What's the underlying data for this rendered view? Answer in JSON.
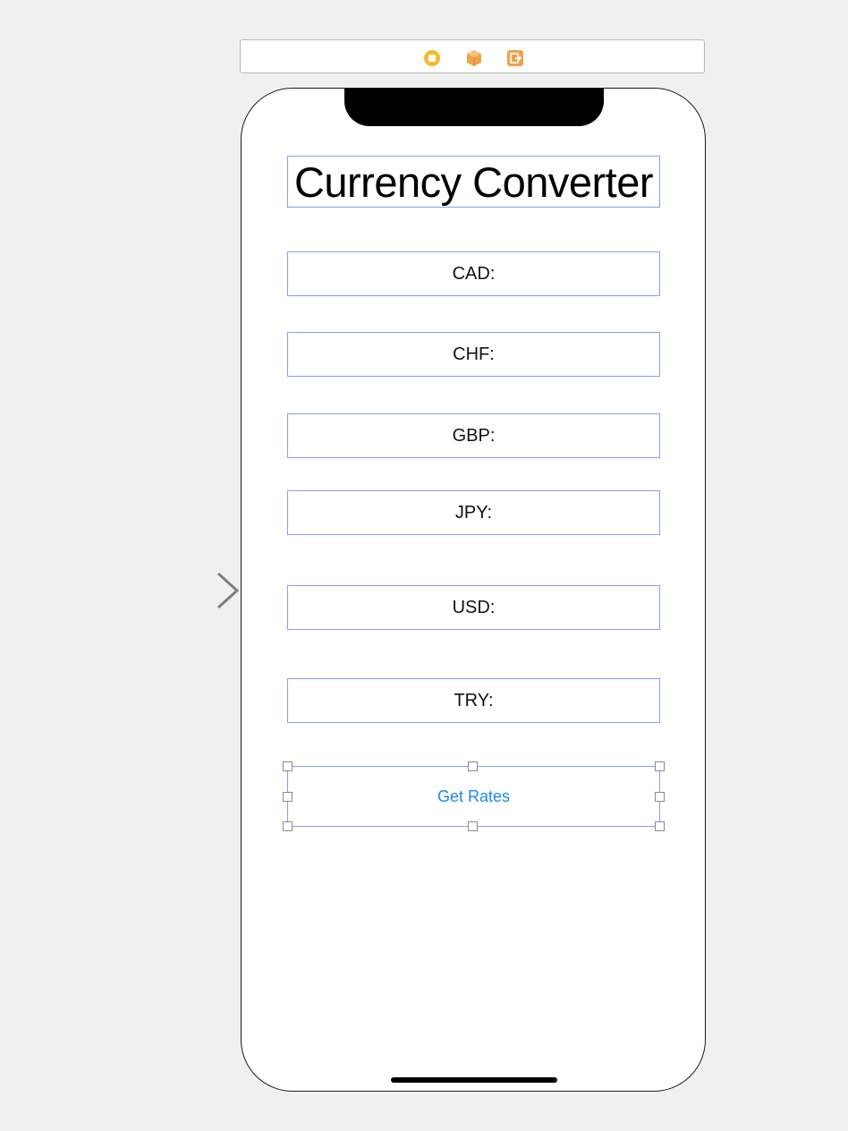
{
  "scene_dock": {
    "icons": [
      "view-controller-icon",
      "first-responder-icon",
      "exit-icon"
    ],
    "colors": {
      "view_controller": "#f5b92e",
      "first_responder": "#f0a24a",
      "exit": "#f0a24a"
    }
  },
  "screen": {
    "title": "Currency Converter",
    "rate_labels": [
      {
        "id": "cad",
        "text": "CAD:"
      },
      {
        "id": "chf",
        "text": "CHF:"
      },
      {
        "id": "gbp",
        "text": "GBP:"
      },
      {
        "id": "jpy",
        "text": "JPY:"
      },
      {
        "id": "usd",
        "text": "USD:"
      },
      {
        "id": "try",
        "text": "TRY:"
      }
    ],
    "get_rates_button": "Get Rates"
  },
  "colors": {
    "selection_outline": "#8c9bf2",
    "button_tint": "#1e88f0",
    "canvas_background": "#f0f0f0"
  }
}
